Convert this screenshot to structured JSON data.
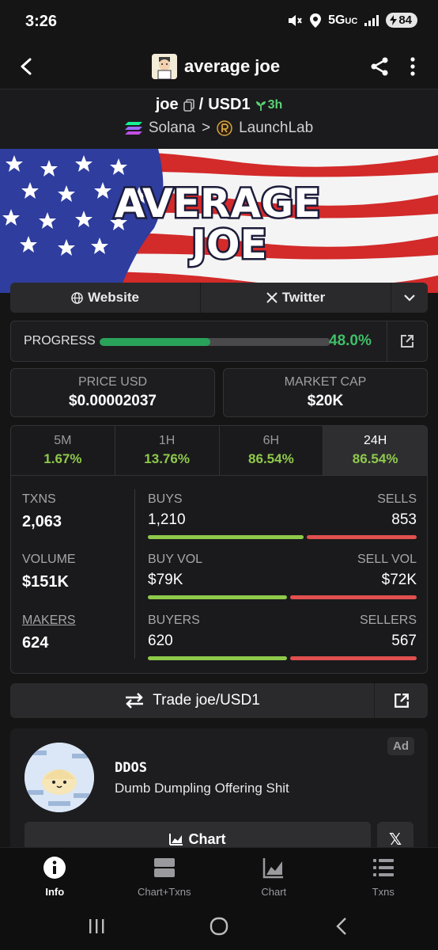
{
  "status_bar": {
    "time": "3:26",
    "network": "5G",
    "network_suffix": "UC",
    "battery": "84"
  },
  "app_bar": {
    "title": "average joe",
    "back_icon": "arrow-left-icon",
    "share_icon": "share-icon",
    "more_icon": "more-vertical-icon"
  },
  "pair": {
    "base": "joe",
    "separator": "/",
    "quote": "USD1",
    "age": "3h",
    "chain": "Solana",
    "chevron": ">",
    "dex": "LaunchLab"
  },
  "banner": {
    "line1": "AVERAGE",
    "line2": "JOE"
  },
  "links": {
    "website": "Website",
    "twitter": "Twitter"
  },
  "progress": {
    "label": "PROGRESS",
    "value": "48.0%",
    "fraction": 0.48
  },
  "stats": {
    "price_label": "PRICE USD",
    "price_value": "$0.00002037",
    "mcap_label": "MARKET CAP",
    "mcap_value": "$20K"
  },
  "timeframes": [
    {
      "label": "5M",
      "value": "1.67%"
    },
    {
      "label": "1H",
      "value": "13.76%"
    },
    {
      "label": "6H",
      "value": "86.54%"
    },
    {
      "label": "24H",
      "value": "86.54%",
      "active": true
    }
  ],
  "metrics": {
    "txns_label": "TXNS",
    "txns_value": "2,063",
    "volume_label": "VOLUME",
    "volume_value": "$151K",
    "makers_label": "MAKERS",
    "makers_value": "624"
  },
  "splits": {
    "buys_label": "BUYS",
    "buys_value": "1,210",
    "sells_label": "SELLS",
    "sells_value": "853",
    "buyvol_label": "BUY VOL",
    "buyvol_value": "$79K",
    "sellvol_label": "SELL VOL",
    "sellvol_value": "$72K",
    "buyers_label": "BUYERS",
    "buyers_value": "620",
    "sellers_label": "SELLERS",
    "sellers_value": "567"
  },
  "trade": {
    "label": "Trade joe/USD1"
  },
  "ad": {
    "badge": "Ad",
    "name": "DDOS",
    "description": "Dumb Dumpling Offering Shit",
    "chart_label": "Chart",
    "x_label": "𝕏"
  },
  "bottom_nav": [
    {
      "label": "Info",
      "icon": "info-icon",
      "active": true
    },
    {
      "label": "Chart+Txns",
      "icon": "chart-txns-icon"
    },
    {
      "label": "Chart",
      "icon": "chart-icon"
    },
    {
      "label": "Txns",
      "icon": "list-icon"
    }
  ],
  "colors": {
    "green": "#8fc94a",
    "red": "#e0504f",
    "progress_green": "#2aa35a",
    "background": "#151516"
  }
}
